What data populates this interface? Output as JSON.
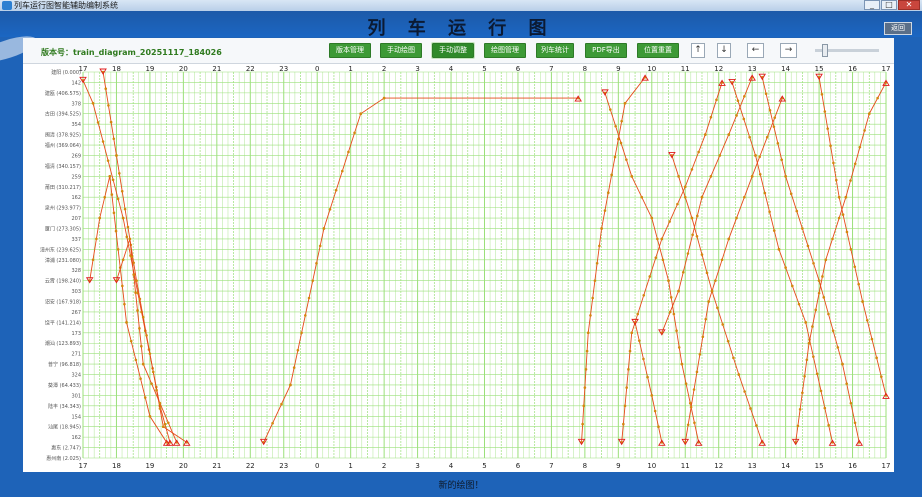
{
  "window": {
    "title": "列车运行图智能辅助编制系统",
    "buttons": [
      "_",
      "□",
      "✕"
    ]
  },
  "header": {
    "title": "列 车 运 行 图",
    "back_label": "返回"
  },
  "toolbar": {
    "version_label": "版本号：train_diagram_20251117_184026",
    "buttons": [
      {
        "label": "版本管理",
        "active": false
      },
      {
        "label": "手动绘图",
        "active": false
      },
      {
        "label": "手动调整",
        "active": true
      },
      {
        "label": "绘图管理",
        "active": false
      },
      {
        "label": "列车统计",
        "active": false
      },
      {
        "label": "PDF导出",
        "active": false
      },
      {
        "label": "位置重置",
        "active": false
      }
    ],
    "nav": [
      "↑",
      "↓",
      "←",
      "→"
    ],
    "zoom_fraction": 0.12
  },
  "diagram": {
    "hours": [
      "17",
      "18",
      "19",
      "20",
      "21",
      "22",
      "23",
      "0",
      "1",
      "2",
      "3",
      "4",
      "5",
      "6",
      "7",
      "8",
      "9",
      "10",
      "11",
      "12",
      "13",
      "14",
      "15",
      "16",
      "17"
    ],
    "stations": [
      {
        "name": "建阳",
        "km": "(0.000)"
      },
      {
        "name": "",
        "km": "142"
      },
      {
        "name": "建瓯",
        "km": "(406.575)"
      },
      {
        "name": "",
        "km": "378"
      },
      {
        "name": "古田",
        "km": "(394.525)"
      },
      {
        "name": "",
        "km": "354"
      },
      {
        "name": "闽清",
        "km": "(378.925)"
      },
      {
        "name": "福州",
        "km": "(369.064)"
      },
      {
        "name": "",
        "km": "269"
      },
      {
        "name": "福清",
        "km": "(340.157)"
      },
      {
        "name": "",
        "km": "259"
      },
      {
        "name": "莆田",
        "km": "(310.217)"
      },
      {
        "name": "",
        "km": "162"
      },
      {
        "name": "泉州",
        "km": "(293.977)"
      },
      {
        "name": "",
        "km": "207"
      },
      {
        "name": "厦门",
        "km": "(273.305)"
      },
      {
        "name": "",
        "km": "337"
      },
      {
        "name": "漳州东",
        "km": "(239.625)"
      },
      {
        "name": "漳浦",
        "km": "(231.080)"
      },
      {
        "name": "",
        "km": "328"
      },
      {
        "name": "云霄",
        "km": "(198.240)"
      },
      {
        "name": "",
        "km": "303"
      },
      {
        "name": "诏安",
        "km": "(167.918)"
      },
      {
        "name": "",
        "km": "267"
      },
      {
        "name": "饶平",
        "km": "(141.214)"
      },
      {
        "name": "",
        "km": "173"
      },
      {
        "name": "潮汕",
        "km": "(123.893)"
      },
      {
        "name": "",
        "km": "271"
      },
      {
        "name": "普宁",
        "km": "(96.818)"
      },
      {
        "name": "",
        "km": "324"
      },
      {
        "name": "葵潭",
        "km": "(64.433)"
      },
      {
        "name": "",
        "km": "301"
      },
      {
        "name": "陆丰",
        "km": "(34.343)"
      },
      {
        "name": "",
        "km": "154"
      },
      {
        "name": "汕尾",
        "km": "(18.945)"
      },
      {
        "name": "",
        "km": "162"
      },
      {
        "name": "惠东",
        "km": "(2.747)"
      },
      {
        "name": "惠州南",
        "km": "(2.025)"
      }
    ],
    "colors": {
      "grid": "#9be07a",
      "train_line": "#e64a19",
      "marker": "#d4880f",
      "endpoint": "#e01b1b",
      "axis_text": "#222222"
    }
  },
  "status_text": "新的绘图！"
}
